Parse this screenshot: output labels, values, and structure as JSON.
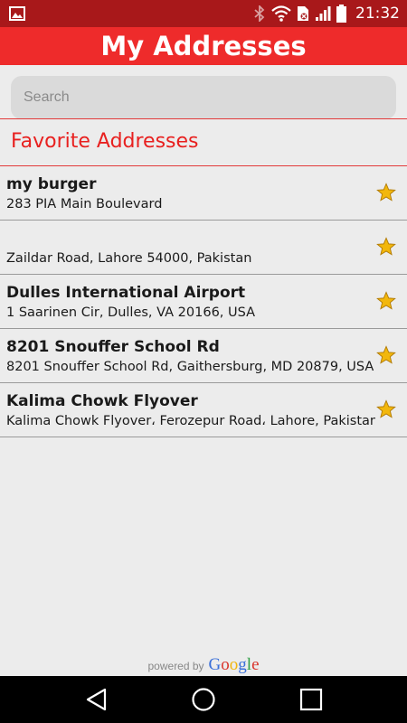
{
  "status_bar": {
    "time": "21:32"
  },
  "header": {
    "title": "My Addresses"
  },
  "search": {
    "placeholder": "Search",
    "value": ""
  },
  "section": {
    "title": "Favorite Addresses"
  },
  "addresses": [
    {
      "name": "my burger",
      "address": "283 PIA Main Boulevard"
    },
    {
      "name": "",
      "address": "Zaildar Road, Lahore 54000, Pakistan"
    },
    {
      "name": "Dulles International Airport",
      "address": "1 Saarinen Cir, Dulles, VA 20166, USA"
    },
    {
      "name": "8201 Snouffer School Rd",
      "address": "8201 Snouffer School Rd, Gaithersburg, MD 20879, USA"
    },
    {
      "name": "Kalima Chowk Flyover",
      "address": "Kalima Chowk Flyover، Ferozepur Road، Lahore, Pakistan"
    }
  ],
  "footer": {
    "powered_by": "powered by",
    "google": "Google"
  },
  "colors": {
    "status_bar": "#a8181a",
    "header": "#ee2b2b",
    "accent": "#e8201f",
    "star": "#f2b70c"
  },
  "icons": {
    "status_left": "image-icon",
    "bluetooth": "bluetooth-icon",
    "wifi": "wifi-icon",
    "sim": "sim-icon",
    "signal": "signal-icon",
    "battery": "battery-icon",
    "favorite": "star-icon",
    "back": "back-icon",
    "home": "home-icon",
    "recents": "recents-icon"
  }
}
